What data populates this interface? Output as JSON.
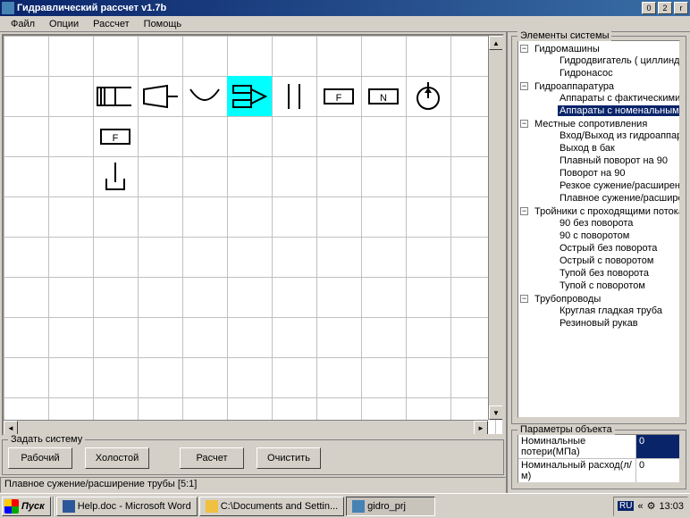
{
  "window": {
    "title": "Гидравлический рассчет v1.7b"
  },
  "menu": {
    "file": "Файл",
    "options": "Опции",
    "calc": "Рассчет",
    "help": "Помощь"
  },
  "tree": {
    "title": "Элементы системы",
    "n0": "Гидромашины",
    "n0_0": "Гидродвигатель ( циллиндр/мотор )",
    "n0_1": "Гидронасос",
    "n1": "Гидроаппаратура",
    "n1_0": "Аппараты с фактическими потерями",
    "n1_1": "Аппараты с номенальными потерями",
    "n2": "Местные сопротивления",
    "n2_0": "Вход/Выход из гидроаппаратуры",
    "n2_1": "Выход в бак",
    "n2_2": "Плавный поворот на 90",
    "n2_3": "Поворот на 90",
    "n2_4": "Резкое сужение/расширение трубы",
    "n2_5": "Плавное сужение/расширение трубы",
    "n3": "Тройники с проходящими потоками",
    "n3_0": "90 без поворота",
    "n3_1": "90 с поворотом",
    "n3_2": "Острый без поворота",
    "n3_3": "Острый с поворотом",
    "n3_4": "Тупой без поворота",
    "n3_5": "Тупой с поворотом",
    "n4": "Трубопроводы",
    "n4_0": "Круглая гладкая труба",
    "n4_1": "Резиновый рукав"
  },
  "params": {
    "title": "Параметры объекта",
    "p0_label": "Номинальные потери(МПа)",
    "p0_val": "0",
    "p1_label": "Номинальный расход(л/м)",
    "p1_val": "0"
  },
  "commands": {
    "group": "Задать систему",
    "work": "Рабочий",
    "idle": "Холостой",
    "calc": "Расчет",
    "clear": "Очистить"
  },
  "status": "Плавное сужение/расширение трубы [5:1]",
  "symbols": {
    "F": "F",
    "N": "N"
  },
  "taskbar": {
    "start": "Пуск",
    "t0": "Help.doc - Microsoft Word",
    "t1": "C:\\Documents and Settin...",
    "t2": "gidro_prj",
    "lang": "RU",
    "time": "13:03"
  }
}
